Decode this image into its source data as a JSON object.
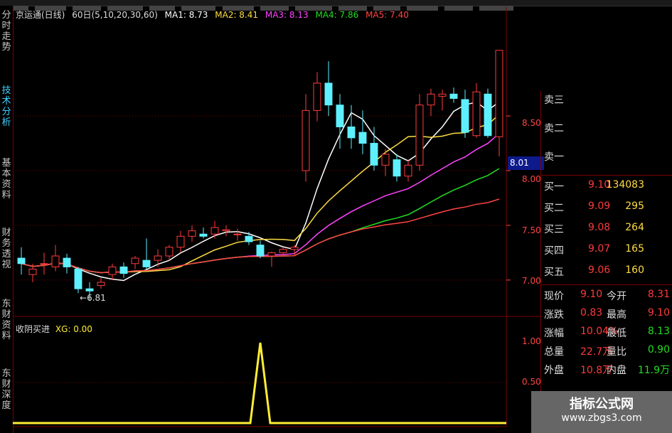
{
  "top_menu": [
    "",
    "",
    "",
    "",
    "",
    "",
    "",
    "",
    "",
    "",
    "",
    "",
    "",
    "",
    "",
    "",
    "",
    ""
  ],
  "nav_tabs": [
    "分时走势",
    "技术分析",
    "基本资料",
    "财务透视",
    "东财资料",
    "东财深度"
  ],
  "header": {
    "title": "京运通(日线)",
    "period": "60日(5,10,20,30,60)",
    "ma": [
      {
        "label": "MA1: 8.73",
        "color": "#ffffff"
      },
      {
        "label": "MA2: 8.41",
        "color": "#ffdd44"
      },
      {
        "label": "MA3: 8.13",
        "color": "#ff44ff"
      },
      {
        "label": "MA4: 7.86",
        "color": "#22dd22"
      },
      {
        "label": "MA5: 7.40",
        "color": "#ff4444"
      }
    ]
  },
  "price_axis": [
    "8.50",
    "8.00",
    "7.50",
    "7.00"
  ],
  "current_price_tag": "8.01",
  "low_marker": "6.81",
  "indicator": {
    "name": "收阴买进",
    "value_label": "XG: 0.00",
    "axis": [
      "1.00",
      "0.50"
    ],
    "signal_value": 1
  },
  "order_book": {
    "sell": [
      {
        "label": "卖三"
      },
      {
        "label": "卖二"
      },
      {
        "label": "卖一"
      }
    ],
    "buy": [
      {
        "label": "买一",
        "price": "9.10",
        "volume": "134083"
      },
      {
        "label": "买二",
        "price": "9.09",
        "volume": "295"
      },
      {
        "label": "买三",
        "price": "9.08",
        "volume": "264"
      },
      {
        "label": "买四",
        "price": "9.07",
        "volume": "165"
      },
      {
        "label": "买五",
        "price": "9.06",
        "volume": "160"
      }
    ]
  },
  "quote": [
    {
      "l1": "现价",
      "v1": "9.10",
      "l2": "今开",
      "v2": "8.31",
      "c2": "#ff3b3b"
    },
    {
      "l1": "涨跌",
      "v1": "0.83",
      "l2": "最高",
      "v2": "9.10",
      "c2": "#ff3b3b"
    },
    {
      "l1": "涨幅",
      "v1": "10.04%",
      "l2": "最低",
      "v2": "8.13",
      "c2": "#22dd22"
    },
    {
      "l1": "总量",
      "v1": "22.7万",
      "l2": "量比",
      "v2": "0.90",
      "c2": "#22dd22"
    },
    {
      "l1": "外盘",
      "v1": "10.8万",
      "l2": "内盘",
      "v2": "11.9万",
      "c2": "#22dd22"
    }
  ],
  "watermark": {
    "line1": "指标公式网",
    "line2": "www.zbgs3.com"
  },
  "colors": {
    "up": "#ff3b3b",
    "down": "#5ef0ff",
    "grid": "#7a0000",
    "signal": "#ffee33"
  },
  "chart_data": {
    "type": "candlestick",
    "y_range": [
      6.7,
      9.3
    ],
    "candles": [
      {
        "o": 7.2,
        "h": 7.3,
        "l": 7.05,
        "c": 7.15
      },
      {
        "o": 7.05,
        "h": 7.15,
        "l": 6.98,
        "c": 7.1
      },
      {
        "o": 7.15,
        "h": 7.25,
        "l": 7.05,
        "c": 7.15
      },
      {
        "o": 7.12,
        "h": 7.32,
        "l": 7.08,
        "c": 7.22
      },
      {
        "o": 7.2,
        "h": 7.24,
        "l": 7.06,
        "c": 7.12
      },
      {
        "o": 7.1,
        "h": 7.12,
        "l": 6.88,
        "c": 6.92
      },
      {
        "o": 6.92,
        "h": 6.98,
        "l": 6.81,
        "c": 6.9
      },
      {
        "o": 6.95,
        "h": 7.02,
        "l": 6.92,
        "c": 6.98
      },
      {
        "o": 7.05,
        "h": 7.15,
        "l": 7.0,
        "c": 7.12
      },
      {
        "o": 7.12,
        "h": 7.16,
        "l": 7.02,
        "c": 7.06
      },
      {
        "o": 7.15,
        "h": 7.22,
        "l": 7.1,
        "c": 7.2
      },
      {
        "o": 7.18,
        "h": 7.38,
        "l": 7.1,
        "c": 7.12
      },
      {
        "o": 7.18,
        "h": 7.28,
        "l": 7.12,
        "c": 7.22
      },
      {
        "o": 7.22,
        "h": 7.32,
        "l": 7.18,
        "c": 7.3
      },
      {
        "o": 7.3,
        "h": 7.45,
        "l": 7.25,
        "c": 7.4
      },
      {
        "o": 7.4,
        "h": 7.5,
        "l": 7.35,
        "c": 7.45
      },
      {
        "o": 7.42,
        "h": 7.48,
        "l": 7.38,
        "c": 7.4
      },
      {
        "o": 7.42,
        "h": 7.54,
        "l": 7.38,
        "c": 7.48
      },
      {
        "o": 7.45,
        "h": 7.5,
        "l": 7.4,
        "c": 7.46
      },
      {
        "o": 7.42,
        "h": 7.47,
        "l": 7.36,
        "c": 7.42
      },
      {
        "o": 7.4,
        "h": 7.44,
        "l": 7.32,
        "c": 7.35
      },
      {
        "o": 7.32,
        "h": 7.36,
        "l": 7.2,
        "c": 7.22
      },
      {
        "o": 7.22,
        "h": 7.26,
        "l": 7.12,
        "c": 7.25
      },
      {
        "o": 7.25,
        "h": 7.3,
        "l": 7.22,
        "c": 7.28
      },
      {
        "o": 7.28,
        "h": 7.32,
        "l": 7.22,
        "c": 7.3
      },
      {
        "o": 8.0,
        "h": 8.7,
        "l": 7.9,
        "c": 8.55
      },
      {
        "o": 8.55,
        "h": 8.9,
        "l": 8.45,
        "c": 8.8
      },
      {
        "o": 8.8,
        "h": 9.0,
        "l": 8.5,
        "c": 8.6
      },
      {
        "o": 8.6,
        "h": 8.7,
        "l": 8.2,
        "c": 8.4
      },
      {
        "o": 8.4,
        "h": 8.6,
        "l": 8.2,
        "c": 8.3
      },
      {
        "o": 8.35,
        "h": 8.55,
        "l": 8.15,
        "c": 8.25
      },
      {
        "o": 8.25,
        "h": 8.4,
        "l": 8.0,
        "c": 8.05
      },
      {
        "o": 8.05,
        "h": 8.2,
        "l": 7.95,
        "c": 8.15
      },
      {
        "o": 8.1,
        "h": 8.15,
        "l": 7.9,
        "c": 7.95
      },
      {
        "o": 7.95,
        "h": 8.1,
        "l": 7.9,
        "c": 8.05
      },
      {
        "o": 8.05,
        "h": 8.7,
        "l": 8.0,
        "c": 8.6
      },
      {
        "o": 8.6,
        "h": 8.75,
        "l": 8.5,
        "c": 8.7
      },
      {
        "o": 8.68,
        "h": 8.74,
        "l": 8.55,
        "c": 8.7
      },
      {
        "o": 8.7,
        "h": 8.76,
        "l": 8.62,
        "c": 8.66
      },
      {
        "o": 8.65,
        "h": 8.74,
        "l": 8.3,
        "c": 8.35
      },
      {
        "o": 8.32,
        "h": 8.8,
        "l": 8.3,
        "c": 8.72
      },
      {
        "o": 8.7,
        "h": 8.75,
        "l": 8.3,
        "c": 8.32
      },
      {
        "o": 8.31,
        "h": 9.1,
        "l": 8.13,
        "c": 9.1
      }
    ],
    "signal_index": 21
  }
}
